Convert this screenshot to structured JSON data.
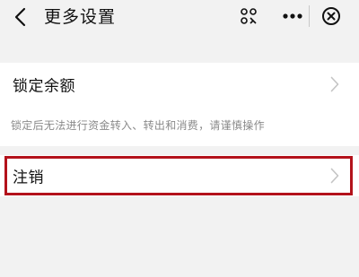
{
  "header": {
    "title": "更多设置",
    "icons": [
      "back-arrow",
      "mini-program",
      "more-dots",
      "close-circle"
    ]
  },
  "settings": {
    "lock_balance_label": "锁定余额",
    "lock_balance_hint": "锁定后无法进行资金转入、转出和消费，请谨慎操作",
    "cancel_label": "注销"
  },
  "colors": {
    "background": "#f2f2f2",
    "highlight_border": "#b3121b"
  }
}
